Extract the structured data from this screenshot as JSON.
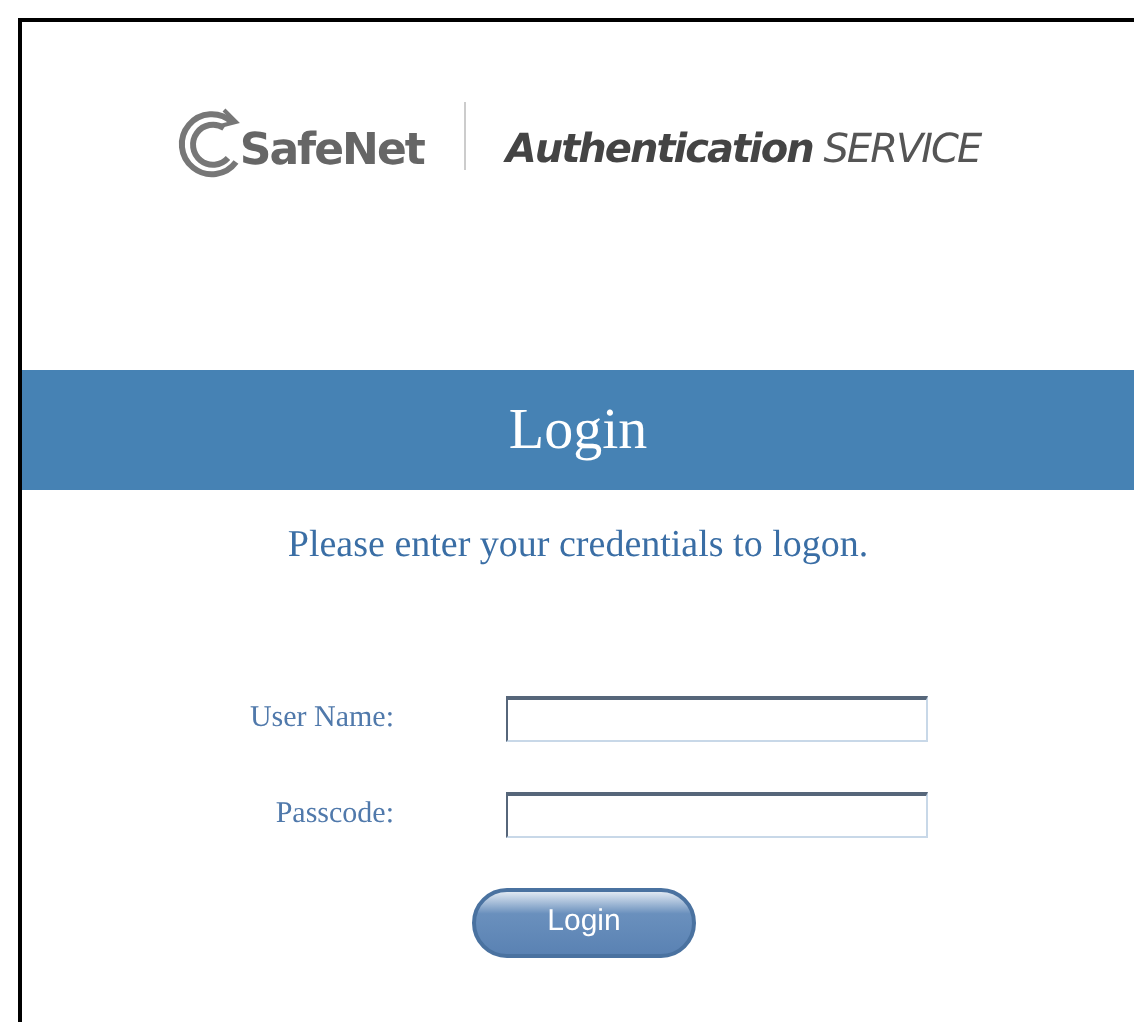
{
  "logo": {
    "brand": "SafeNet",
    "product": "Authentication",
    "product_suffix": "SERVICE"
  },
  "banner": {
    "title": "Login"
  },
  "instructions": "Please enter your credentials to logon.",
  "fields": [
    {
      "label": "User Name:"
    },
    {
      "label": "Passcode:"
    }
  ],
  "button": {
    "label": "Login"
  }
}
